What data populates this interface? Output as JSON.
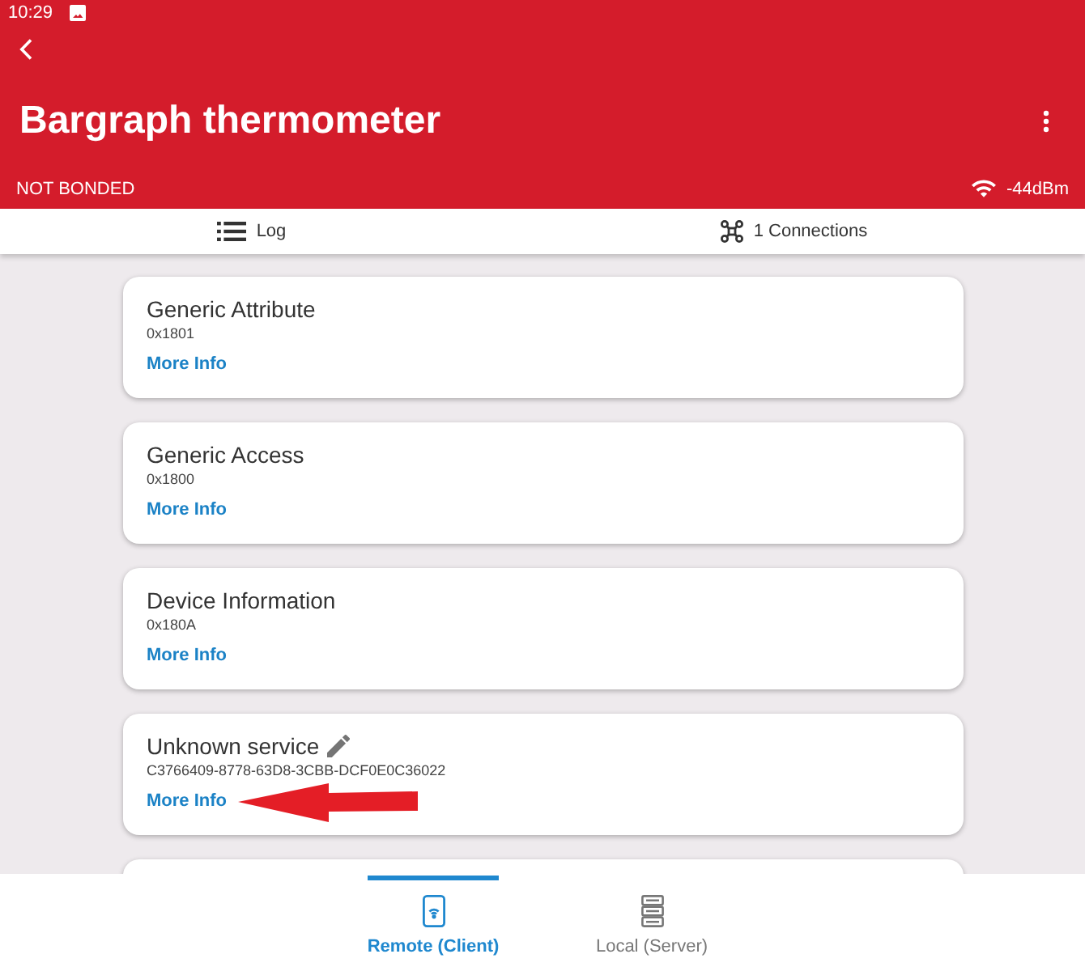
{
  "status_bar": {
    "time": "10:29"
  },
  "app_bar": {
    "title": "Bargraph thermometer",
    "bond_state": "NOT BONDED",
    "rssi": "-44dBm"
  },
  "tabs": [
    {
      "label": "Log",
      "kind": "log"
    },
    {
      "label": "1 Connections",
      "kind": "connections"
    }
  ],
  "services": {
    "more_below": true,
    "items": [
      {
        "name": "Generic Attribute",
        "uuid": "0x1801",
        "link": "More Info",
        "editable": false,
        "arrow_marker": false
      },
      {
        "name": "Generic Access",
        "uuid": "0x1800",
        "link": "More Info",
        "editable": false,
        "arrow_marker": false
      },
      {
        "name": "Device Information",
        "uuid": "0x180A",
        "link": "More Info",
        "editable": false,
        "arrow_marker": false
      },
      {
        "name": "Unknown service",
        "uuid": "C3766409-8778-63D8-3CBB-DCF0E0C36022",
        "link": "More Info",
        "editable": true,
        "arrow_marker": true
      }
    ]
  },
  "bottom_nav": [
    {
      "label": "Remote (Client)",
      "kind": "remote",
      "selected": true
    },
    {
      "label": "Local (Server)",
      "kind": "local",
      "selected": false
    }
  ]
}
